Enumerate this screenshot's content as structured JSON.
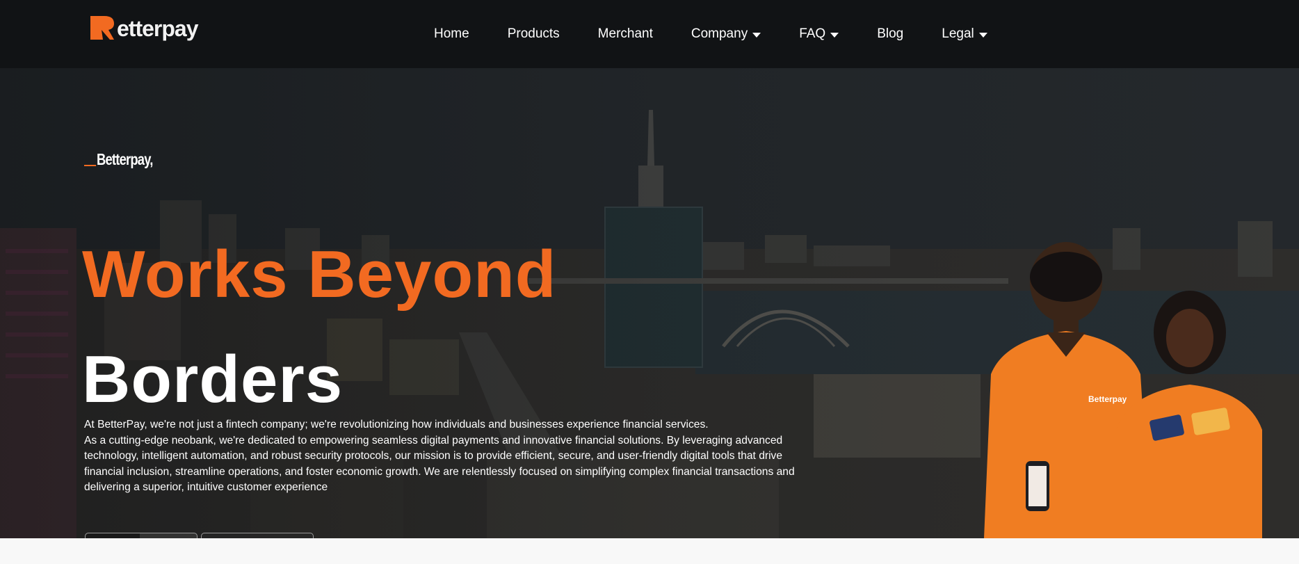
{
  "nav": {
    "logo_text": "etterpay",
    "items": [
      {
        "label": "Home",
        "has_dropdown": false
      },
      {
        "label": "Products",
        "has_dropdown": false
      },
      {
        "label": "Merchant",
        "has_dropdown": false
      },
      {
        "label": "Company",
        "has_dropdown": true
      },
      {
        "label": "FAQ",
        "has_dropdown": true
      },
      {
        "label": "Blog",
        "has_dropdown": false
      },
      {
        "label": "Legal",
        "has_dropdown": true
      }
    ]
  },
  "hero": {
    "brand_tag": "Betterpay,",
    "headline_line1": "Works Beyond",
    "headline_line2": "Borders",
    "intro_line1": "At BetterPay, we're not just a fintech company; we're revolutionizing how individuals and businesses experience financial services.",
    "intro_line2": "As a cutting-edge neobank, we're dedicated to empowering seamless digital payments and innovative financial solutions. By leveraging advanced technology, intelligent automation, and robust security protocols, our mission is to provide efficient, secure, and user-friendly digital tools that drive financial inclusion, streamline operations, and foster economic growth. We are relentlessly focused on simplifying complex financial transactions and delivering a superior, intuitive customer experience",
    "shirt_logo_text": "Betterpay"
  },
  "colors": {
    "accent": "#f26a21",
    "nav_bg": "#111315",
    "text_light": "#ffffff"
  },
  "icons": {
    "dropdown": "caret-down-icon",
    "logo": "betterpay-logo-icon"
  }
}
